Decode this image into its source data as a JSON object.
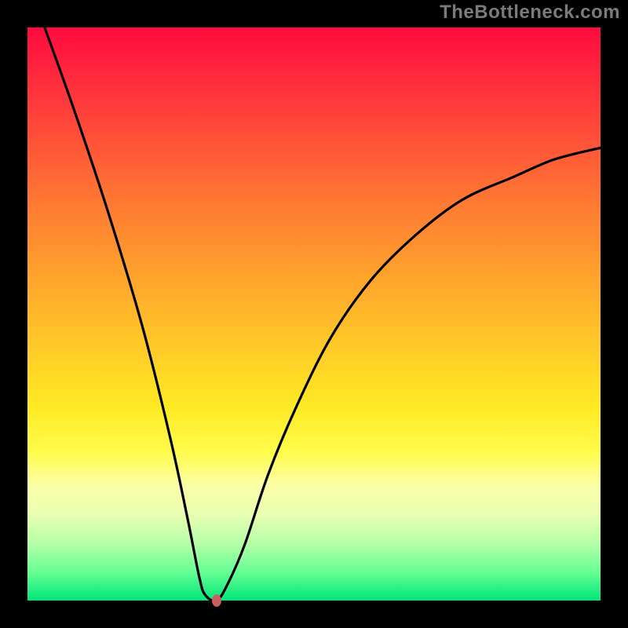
{
  "watermark": "TheBottleneck.com",
  "chart_data": {
    "type": "line",
    "title": "",
    "xlabel": "",
    "ylabel": "",
    "xlim": [
      0,
      100
    ],
    "ylim": [
      0,
      100
    ],
    "grid": false,
    "legend": false,
    "series": [
      {
        "name": "curve",
        "x": [
          3,
          8,
          14,
          20,
          25,
          28,
          30,
          31,
          33,
          35,
          38,
          42,
          47,
          53,
          60,
          68,
          76,
          85,
          92,
          100
        ],
        "y": [
          100,
          86,
          68,
          48,
          28,
          14,
          4,
          1,
          0,
          3,
          10,
          22,
          34,
          46,
          56,
          64,
          70,
          74,
          77,
          79
        ]
      }
    ],
    "marker": {
      "x": 33,
      "y": 0,
      "color": "#c9605f"
    },
    "gradient_stops": [
      {
        "pos": 0,
        "color": "#ff0a3e"
      },
      {
        "pos": 10,
        "color": "#ff2f3d"
      },
      {
        "pos": 22,
        "color": "#ff5a37"
      },
      {
        "pos": 32,
        "color": "#ff7e32"
      },
      {
        "pos": 43,
        "color": "#ffa22d"
      },
      {
        "pos": 55,
        "color": "#ffc828"
      },
      {
        "pos": 66,
        "color": "#ffe924"
      },
      {
        "pos": 74,
        "color": "#fffc4a"
      },
      {
        "pos": 80,
        "color": "#fcffa8"
      },
      {
        "pos": 85,
        "color": "#e9ffb2"
      },
      {
        "pos": 90,
        "color": "#b6ffa8"
      },
      {
        "pos": 95,
        "color": "#66ff94"
      },
      {
        "pos": 100,
        "color": "#00e67a"
      }
    ]
  }
}
